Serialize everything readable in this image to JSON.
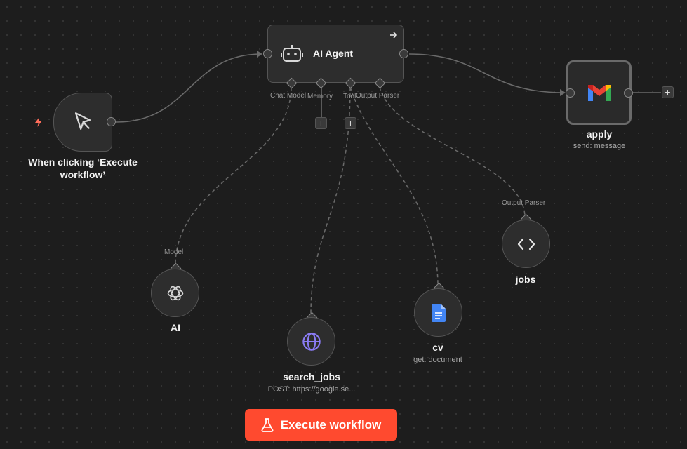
{
  "nodes": {
    "trigger": {
      "label": "When clicking ‘Execute workflow’"
    },
    "agent": {
      "label": "AI Agent"
    },
    "apply": {
      "label": "apply",
      "subtitle": "send: message"
    },
    "ai": {
      "label": "AI"
    },
    "search_jobs": {
      "label": "search_jobs",
      "subtitle": "POST: https://google.se..."
    },
    "cv": {
      "label": "cv",
      "subtitle": "get: document"
    },
    "jobs": {
      "label": "jobs"
    }
  },
  "agent_ports": [
    "Chat Model",
    "Memory",
    "Tool",
    "Output Parser"
  ],
  "input_labels": {
    "model": "Model",
    "output_parser": "Output Parser"
  },
  "plus_symbol": "+",
  "execute_button": {
    "label": "Execute workflow"
  },
  "colors": {
    "accent": "#ff4a2f",
    "trigger_bolt": "#ff6d5a",
    "globe": "#8b7cf6",
    "docs": "#4285f4"
  },
  "icons": {
    "trigger": "cursor-icon",
    "agent": "robot-icon",
    "apply": "gmail-icon",
    "ai": "openai-icon",
    "search_jobs": "globe-icon",
    "cv": "google-docs-icon",
    "jobs": "code-brackets-icon",
    "execute": "flask-icon"
  }
}
